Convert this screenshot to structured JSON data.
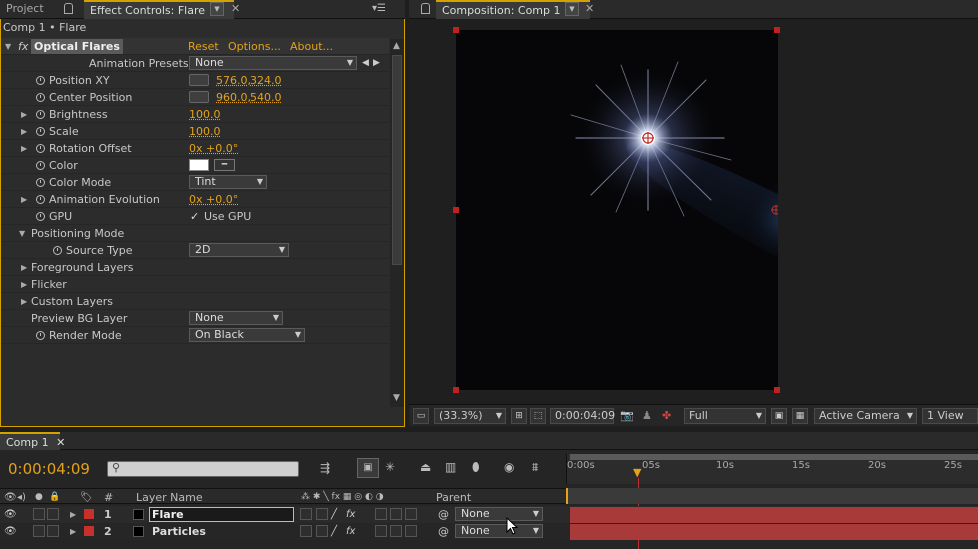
{
  "left_tabs": {
    "project": "Project",
    "effect_controls": "Effect Controls: Flare"
  },
  "comp_tabs": {
    "composition": "Composition: Comp 1"
  },
  "breadcrumb": "Comp 1 • Flare",
  "effect": {
    "fx": "fx",
    "name": "Optical Flares",
    "reset": "Reset",
    "options": "Options...",
    "about": "About..."
  },
  "params": {
    "animation_presets": {
      "label": "Animation Presets:",
      "value": "None"
    },
    "position_xy": {
      "label": "Position XY",
      "x": "576.0,",
      "y": "324.0"
    },
    "center_position": {
      "label": "Center Position",
      "x": "960.0,",
      "y": "540.0"
    },
    "brightness": {
      "label": "Brightness",
      "value": "100.0"
    },
    "scale": {
      "label": "Scale",
      "value": "100.0"
    },
    "rotation_offset": {
      "label": "Rotation Offset",
      "value": "0x +0.0°"
    },
    "color": {
      "label": "Color",
      "swatch": "#ffffff"
    },
    "color_mode": {
      "label": "Color Mode",
      "value": "Tint"
    },
    "animation_evolution": {
      "label": "Animation Evolution",
      "value": "0x +0.0°"
    },
    "gpu": {
      "label": "GPU",
      "check": "✓",
      "checkbox_label": "Use GPU"
    },
    "positioning_mode": {
      "label": "Positioning Mode"
    },
    "source_type": {
      "label": "Source Type",
      "value": "2D"
    },
    "foreground_layers": {
      "label": "Foreground Layers"
    },
    "flicker": {
      "label": "Flicker"
    },
    "custom_layers": {
      "label": "Custom Layers"
    },
    "preview_bg_layer": {
      "label": "Preview BG Layer",
      "value": "None"
    },
    "render_mode": {
      "label": "Render Mode",
      "value": "On Black"
    }
  },
  "comp_toolbar": {
    "zoom": "(33.3%)",
    "timecode": "0:00:04:09",
    "resolution": "Full",
    "camera": "Active Camera",
    "view": "1 View"
  },
  "timeline": {
    "tab": "Comp 1",
    "timecode": "0:00:04:09",
    "columns": {
      "num": "#",
      "layer_name": "Layer Name",
      "parent": "Parent"
    },
    "ruler": [
      "0:00s",
      "05s",
      "10s",
      "15s",
      "20s",
      "25s"
    ],
    "current_time_seconds": 4.4,
    "layers": [
      {
        "num": "1",
        "name": "Flare",
        "parent": "None"
      },
      {
        "num": "2",
        "name": "Particles",
        "parent": "None"
      }
    ]
  },
  "colors": {
    "accent": "#d4a200",
    "value": "#e2a21a",
    "label_red": "#c8302c",
    "layer_bar": "#a83a3a"
  }
}
